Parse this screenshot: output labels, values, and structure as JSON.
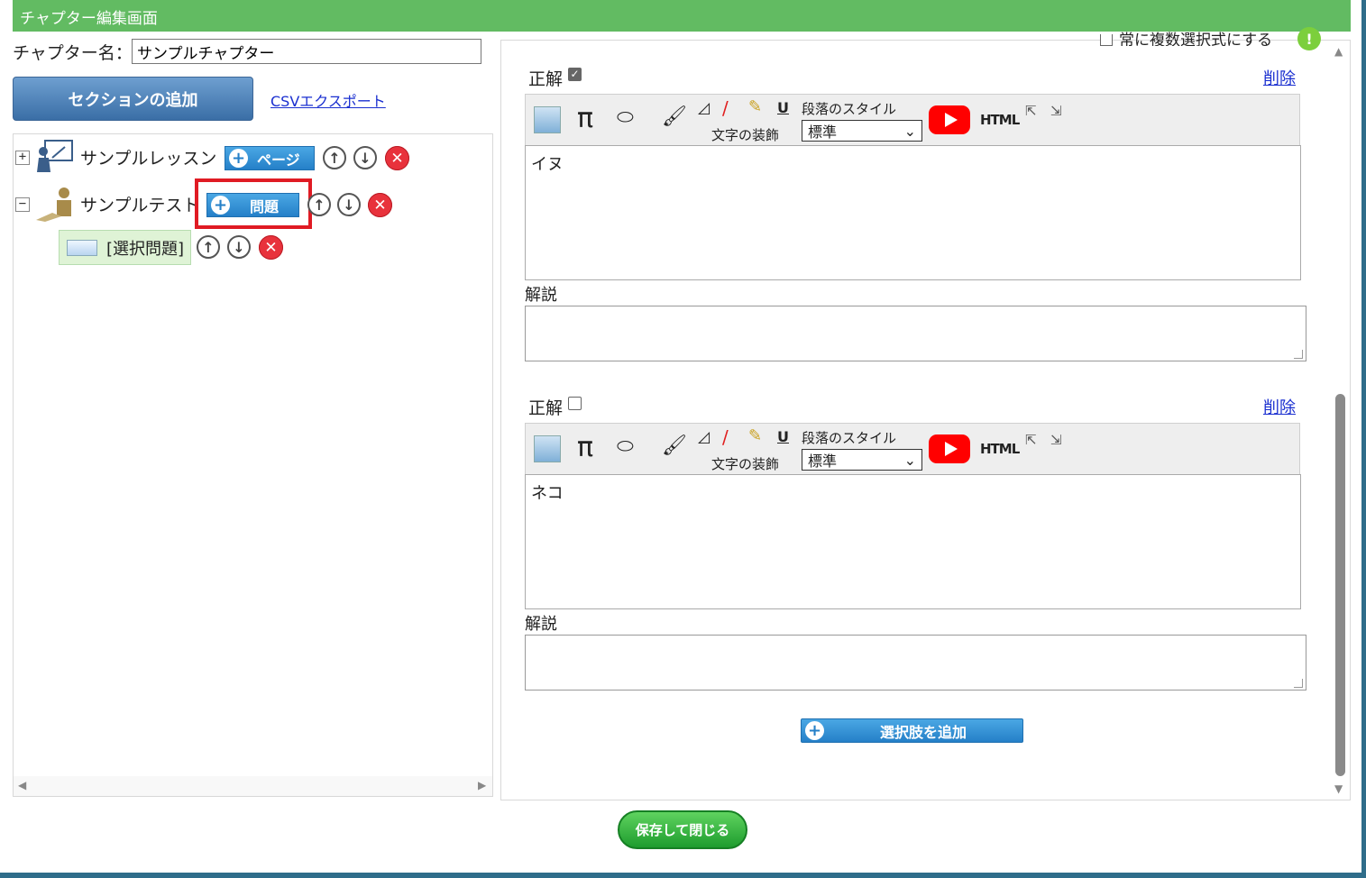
{
  "header": {
    "title": "チャプター編集画面"
  },
  "chapter": {
    "label": "チャプター名：",
    "value": "サンプルチャプター"
  },
  "toolbar": {
    "add_section": "セクションの追加",
    "csv_export": "CSVエクスポート"
  },
  "tree": {
    "lesson": {
      "expander": "+",
      "label": "サンプルレッスン",
      "add_label": "ページ"
    },
    "test": {
      "expander": "−",
      "label": "サンプルテスト",
      "add_label": "問題"
    },
    "question": {
      "label": "[選択問題]"
    }
  },
  "editor": {
    "multi_option_label": "常に複数選択式にする",
    "correct_label": "正解",
    "delete_label": "削除",
    "decoration_label": "文字の装飾",
    "paragraph_style_label": "段落のスタイル",
    "style_value": "標準",
    "explanation_label": "解説",
    "html_label": "HTML",
    "choices": [
      {
        "text": "イヌ",
        "correct": true
      },
      {
        "text": "ネコ",
        "correct": false
      }
    ],
    "add_choice": "選択肢を追加"
  },
  "footer": {
    "save_close": "保存して閉じる"
  },
  "colors": {
    "header_green": "#62bb62",
    "accent_blue": "#2580c8",
    "highlight_red": "#e01b24"
  }
}
